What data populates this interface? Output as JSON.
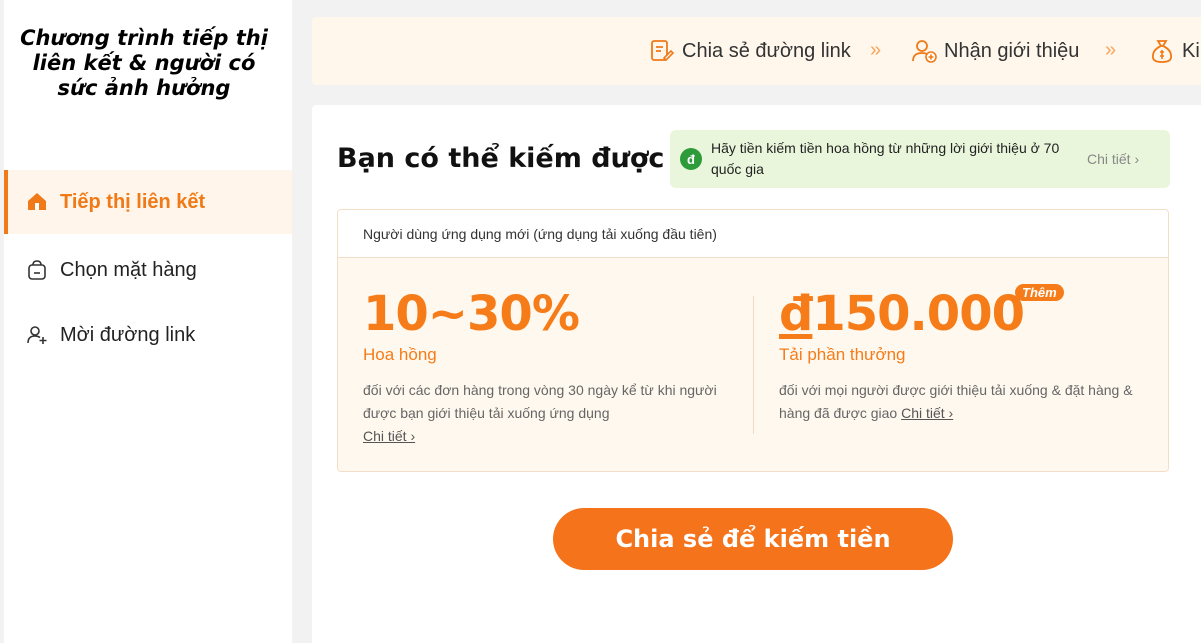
{
  "sidebar": {
    "brand": "Chương trình tiếp thị liên kết & người có sức ảnh hưởng",
    "items": [
      {
        "label": "Tiếp thị liên kết",
        "icon": "home-icon",
        "active": true
      },
      {
        "label": "Chọn mặt hàng",
        "icon": "bag-icon",
        "active": false
      },
      {
        "label": "Mời đường link",
        "icon": "add-user-icon",
        "active": false
      }
    ]
  },
  "steps": {
    "items": [
      {
        "label": "Chia sẻ đường link",
        "icon": "share-link-icon"
      },
      {
        "label": "Nhận giới thiệu",
        "icon": "add-user-icon"
      },
      {
        "label": "Ki",
        "icon": "money-bag-icon"
      }
    ],
    "separator": "»"
  },
  "main": {
    "title": "Bạn có thể kiếm được",
    "banner": {
      "badge": "đ",
      "text": "Hãy tiền kiếm tiền hoa hồng từ những lời giới thiệu ở 70 quốc gia",
      "link": "Chi tiết ›"
    },
    "reward": {
      "header": "Người dùng ứng dụng mới (ứng dụng tải xuống đầu tiên)",
      "commission": {
        "value": "10~30%",
        "label": "Hoa hồng",
        "desc": "đối với các đơn hàng trong vòng 30 ngày kể từ khi người được bạn giới thiệu tải xuống ứng dụng",
        "link": "Chi tiết ›"
      },
      "download": {
        "currency": "đ",
        "value": "150.000",
        "tag": "Thêm",
        "label": "Tải phần thưởng",
        "desc": "đối với mọi người được giới thiệu tải xuống & đặt hàng & hàng đã được giao",
        "link": "Chi tiết ›"
      }
    },
    "cta": "Chia sẻ để kiếm tiền"
  },
  "colors": {
    "accent": "#f57c19",
    "banner_bg": "#e9f6dc",
    "steps_bg": "#fff7ec"
  }
}
